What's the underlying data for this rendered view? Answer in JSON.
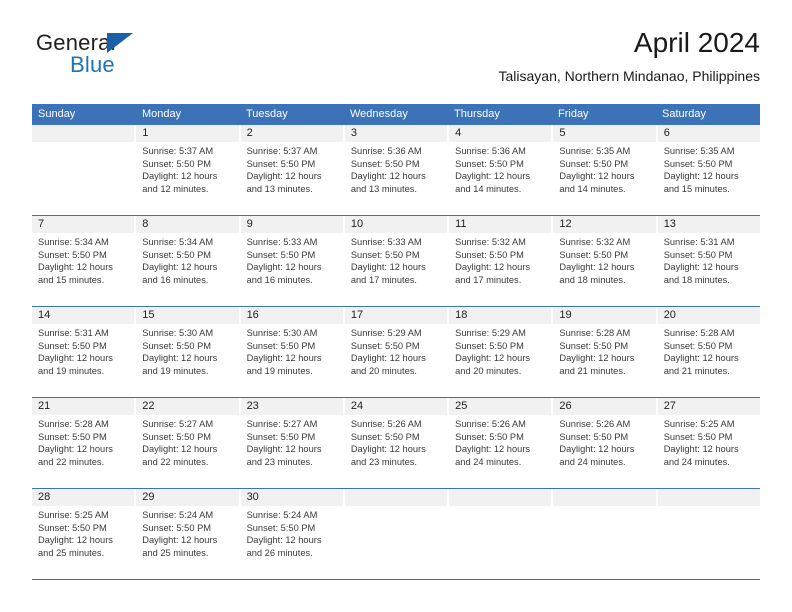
{
  "logo": {
    "word_one": "General",
    "word_two": "Blue",
    "triangle_icon": "blue-triangle-icon"
  },
  "header": {
    "title": "April 2024",
    "subtitle": "Talisayan, Northern Mindanao, Philippines"
  },
  "colors": {
    "header_blue": "#3b72b8",
    "logo_blue": "#1b74bb",
    "day_band_gray": "#f1f1f1",
    "text": "#222222"
  },
  "calendar": {
    "weekdays": [
      "Sunday",
      "Monday",
      "Tuesday",
      "Wednesday",
      "Thursday",
      "Friday",
      "Saturday"
    ],
    "weeks": [
      [
        {
          "date": "",
          "sunrise": "",
          "sunset": "",
          "daylight_line1": "",
          "daylight_line2": ""
        },
        {
          "date": "1",
          "sunrise": "Sunrise: 5:37 AM",
          "sunset": "Sunset: 5:50 PM",
          "daylight_line1": "Daylight: 12 hours",
          "daylight_line2": "and 12 minutes."
        },
        {
          "date": "2",
          "sunrise": "Sunrise: 5:37 AM",
          "sunset": "Sunset: 5:50 PM",
          "daylight_line1": "Daylight: 12 hours",
          "daylight_line2": "and 13 minutes."
        },
        {
          "date": "3",
          "sunrise": "Sunrise: 5:36 AM",
          "sunset": "Sunset: 5:50 PM",
          "daylight_line1": "Daylight: 12 hours",
          "daylight_line2": "and 13 minutes."
        },
        {
          "date": "4",
          "sunrise": "Sunrise: 5:36 AM",
          "sunset": "Sunset: 5:50 PM",
          "daylight_line1": "Daylight: 12 hours",
          "daylight_line2": "and 14 minutes."
        },
        {
          "date": "5",
          "sunrise": "Sunrise: 5:35 AM",
          "sunset": "Sunset: 5:50 PM",
          "daylight_line1": "Daylight: 12 hours",
          "daylight_line2": "and 14 minutes."
        },
        {
          "date": "6",
          "sunrise": "Sunrise: 5:35 AM",
          "sunset": "Sunset: 5:50 PM",
          "daylight_line1": "Daylight: 12 hours",
          "daylight_line2": "and 15 minutes."
        }
      ],
      [
        {
          "date": "7",
          "sunrise": "Sunrise: 5:34 AM",
          "sunset": "Sunset: 5:50 PM",
          "daylight_line1": "Daylight: 12 hours",
          "daylight_line2": "and 15 minutes."
        },
        {
          "date": "8",
          "sunrise": "Sunrise: 5:34 AM",
          "sunset": "Sunset: 5:50 PM",
          "daylight_line1": "Daylight: 12 hours",
          "daylight_line2": "and 16 minutes."
        },
        {
          "date": "9",
          "sunrise": "Sunrise: 5:33 AM",
          "sunset": "Sunset: 5:50 PM",
          "daylight_line1": "Daylight: 12 hours",
          "daylight_line2": "and 16 minutes."
        },
        {
          "date": "10",
          "sunrise": "Sunrise: 5:33 AM",
          "sunset": "Sunset: 5:50 PM",
          "daylight_line1": "Daylight: 12 hours",
          "daylight_line2": "and 17 minutes."
        },
        {
          "date": "11",
          "sunrise": "Sunrise: 5:32 AM",
          "sunset": "Sunset: 5:50 PM",
          "daylight_line1": "Daylight: 12 hours",
          "daylight_line2": "and 17 minutes."
        },
        {
          "date": "12",
          "sunrise": "Sunrise: 5:32 AM",
          "sunset": "Sunset: 5:50 PM",
          "daylight_line1": "Daylight: 12 hours",
          "daylight_line2": "and 18 minutes."
        },
        {
          "date": "13",
          "sunrise": "Sunrise: 5:31 AM",
          "sunset": "Sunset: 5:50 PM",
          "daylight_line1": "Daylight: 12 hours",
          "daylight_line2": "and 18 minutes."
        }
      ],
      [
        {
          "date": "14",
          "sunrise": "Sunrise: 5:31 AM",
          "sunset": "Sunset: 5:50 PM",
          "daylight_line1": "Daylight: 12 hours",
          "daylight_line2": "and 19 minutes."
        },
        {
          "date": "15",
          "sunrise": "Sunrise: 5:30 AM",
          "sunset": "Sunset: 5:50 PM",
          "daylight_line1": "Daylight: 12 hours",
          "daylight_line2": "and 19 minutes."
        },
        {
          "date": "16",
          "sunrise": "Sunrise: 5:30 AM",
          "sunset": "Sunset: 5:50 PM",
          "daylight_line1": "Daylight: 12 hours",
          "daylight_line2": "and 19 minutes."
        },
        {
          "date": "17",
          "sunrise": "Sunrise: 5:29 AM",
          "sunset": "Sunset: 5:50 PM",
          "daylight_line1": "Daylight: 12 hours",
          "daylight_line2": "and 20 minutes."
        },
        {
          "date": "18",
          "sunrise": "Sunrise: 5:29 AM",
          "sunset": "Sunset: 5:50 PM",
          "daylight_line1": "Daylight: 12 hours",
          "daylight_line2": "and 20 minutes."
        },
        {
          "date": "19",
          "sunrise": "Sunrise: 5:28 AM",
          "sunset": "Sunset: 5:50 PM",
          "daylight_line1": "Daylight: 12 hours",
          "daylight_line2": "and 21 minutes."
        },
        {
          "date": "20",
          "sunrise": "Sunrise: 5:28 AM",
          "sunset": "Sunset: 5:50 PM",
          "daylight_line1": "Daylight: 12 hours",
          "daylight_line2": "and 21 minutes."
        }
      ],
      [
        {
          "date": "21",
          "sunrise": "Sunrise: 5:28 AM",
          "sunset": "Sunset: 5:50 PM",
          "daylight_line1": "Daylight: 12 hours",
          "daylight_line2": "and 22 minutes."
        },
        {
          "date": "22",
          "sunrise": "Sunrise: 5:27 AM",
          "sunset": "Sunset: 5:50 PM",
          "daylight_line1": "Daylight: 12 hours",
          "daylight_line2": "and 22 minutes."
        },
        {
          "date": "23",
          "sunrise": "Sunrise: 5:27 AM",
          "sunset": "Sunset: 5:50 PM",
          "daylight_line1": "Daylight: 12 hours",
          "daylight_line2": "and 23 minutes."
        },
        {
          "date": "24",
          "sunrise": "Sunrise: 5:26 AM",
          "sunset": "Sunset: 5:50 PM",
          "daylight_line1": "Daylight: 12 hours",
          "daylight_line2": "and 23 minutes."
        },
        {
          "date": "25",
          "sunrise": "Sunrise: 5:26 AM",
          "sunset": "Sunset: 5:50 PM",
          "daylight_line1": "Daylight: 12 hours",
          "daylight_line2": "and 24 minutes."
        },
        {
          "date": "26",
          "sunrise": "Sunrise: 5:26 AM",
          "sunset": "Sunset: 5:50 PM",
          "daylight_line1": "Daylight: 12 hours",
          "daylight_line2": "and 24 minutes."
        },
        {
          "date": "27",
          "sunrise": "Sunrise: 5:25 AM",
          "sunset": "Sunset: 5:50 PM",
          "daylight_line1": "Daylight: 12 hours",
          "daylight_line2": "and 24 minutes."
        }
      ],
      [
        {
          "date": "28",
          "sunrise": "Sunrise: 5:25 AM",
          "sunset": "Sunset: 5:50 PM",
          "daylight_line1": "Daylight: 12 hours",
          "daylight_line2": "and 25 minutes."
        },
        {
          "date": "29",
          "sunrise": "Sunrise: 5:24 AM",
          "sunset": "Sunset: 5:50 PM",
          "daylight_line1": "Daylight: 12 hours",
          "daylight_line2": "and 25 minutes."
        },
        {
          "date": "30",
          "sunrise": "Sunrise: 5:24 AM",
          "sunset": "Sunset: 5:50 PM",
          "daylight_line1": "Daylight: 12 hours",
          "daylight_line2": "and 26 minutes."
        },
        {
          "date": "",
          "sunrise": "",
          "sunset": "",
          "daylight_line1": "",
          "daylight_line2": ""
        },
        {
          "date": "",
          "sunrise": "",
          "sunset": "",
          "daylight_line1": "",
          "daylight_line2": ""
        },
        {
          "date": "",
          "sunrise": "",
          "sunset": "",
          "daylight_line1": "",
          "daylight_line2": ""
        },
        {
          "date": "",
          "sunrise": "",
          "sunset": "",
          "daylight_line1": "",
          "daylight_line2": ""
        }
      ]
    ]
  }
}
